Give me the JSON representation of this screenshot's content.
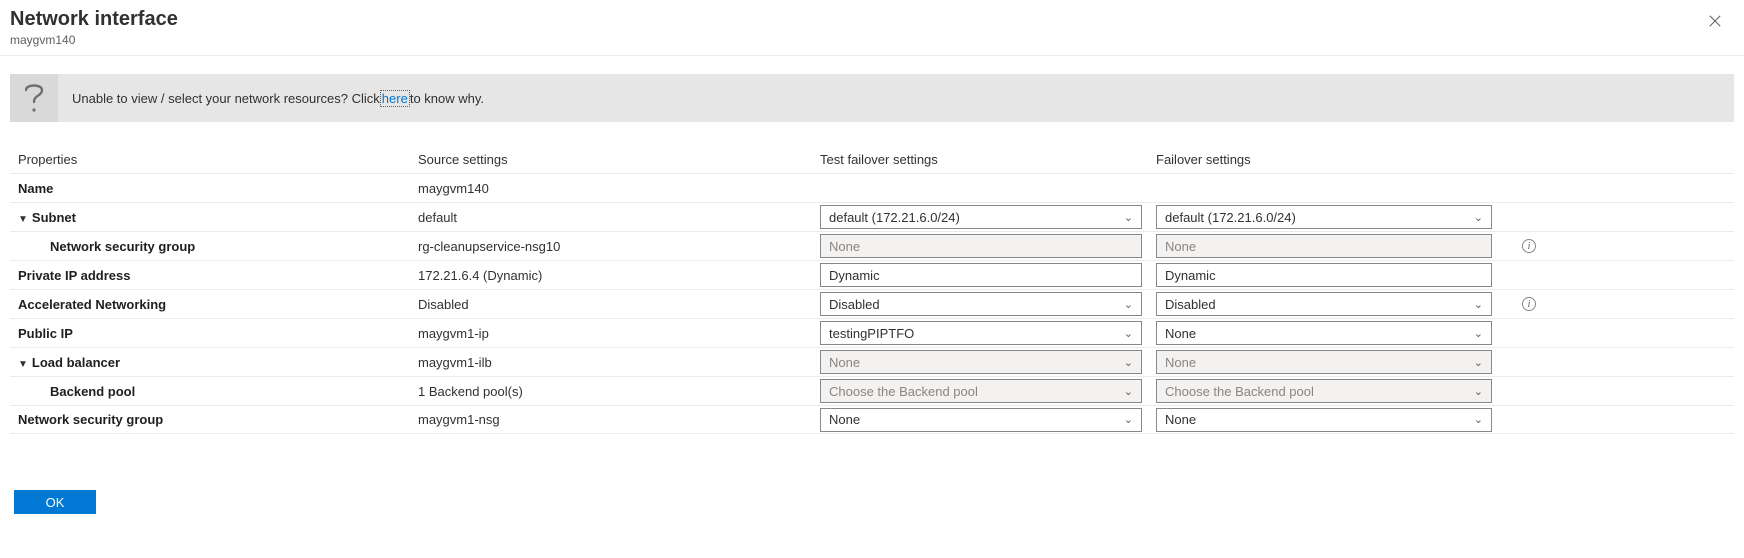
{
  "header": {
    "title": "Network interface",
    "subtitle": "maygvm140"
  },
  "banner": {
    "text_before": "Unable to view / select your network resources? Click ",
    "link": "here",
    "text_after": " to know why."
  },
  "columns": {
    "properties": "Properties",
    "source": "Source settings",
    "test_failover": "Test failover settings",
    "failover": "Failover settings"
  },
  "rows": {
    "name": {
      "label": "Name",
      "source": "maygvm140"
    },
    "subnet": {
      "label": "Subnet",
      "source": "default",
      "tf": "default (172.21.6.0/24)",
      "fo": "default (172.21.6.0/24)"
    },
    "nsg_child": {
      "label": "Network security group",
      "source": "rg-cleanupservice-nsg10",
      "tf": "None",
      "fo": "None"
    },
    "private_ip": {
      "label": "Private IP address",
      "source": "172.21.6.4 (Dynamic)",
      "tf": "Dynamic",
      "fo": "Dynamic"
    },
    "accel_net": {
      "label": "Accelerated Networking",
      "source": "Disabled",
      "tf": "Disabled",
      "fo": "Disabled"
    },
    "public_ip": {
      "label": "Public IP",
      "source": "maygvm1-ip",
      "tf": "testingPIPTFO",
      "fo": "None"
    },
    "lb": {
      "label": "Load balancer",
      "source": "maygvm1-ilb",
      "tf": "None",
      "fo": "None"
    },
    "backend": {
      "label": "Backend pool",
      "source": "1 Backend pool(s)",
      "tf": "Choose the Backend pool",
      "fo": "Choose the Backend pool"
    },
    "nsg_bottom": {
      "label": "Network security group",
      "source": "maygvm1-nsg",
      "tf": "None",
      "fo": "None"
    }
  },
  "footer": {
    "ok": "OK"
  }
}
